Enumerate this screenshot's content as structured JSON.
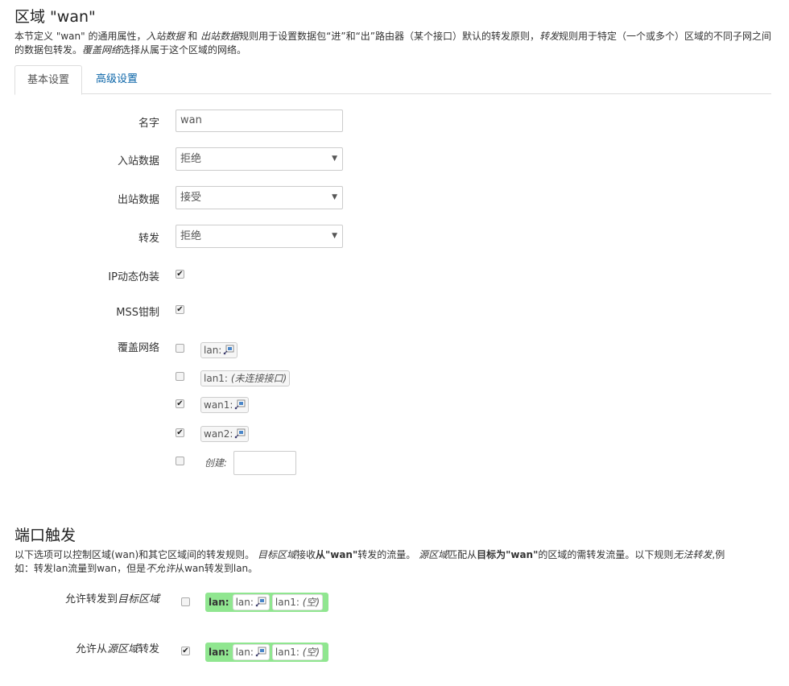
{
  "zone_section": {
    "title": "区域 \"wan\"",
    "desc_parts": [
      "本节定义 \"wan\" 的通用属性，",
      "入站数据",
      "和",
      "出站数据",
      "规则用于设置数据包“进”和“出”路由器（某个接口）默认的转发原则，",
      "转发",
      "规则用于特定（一个或多个）区域的不同子网之间的数据包转发。",
      "覆盖网络",
      "选择从属于这个区域的网络。"
    ]
  },
  "tabs": {
    "basic": "基本设置",
    "advanced": "高级设置"
  },
  "form": {
    "name_label": "名字",
    "name_value": "wan",
    "input_label": "入站数据",
    "input_value": "拒绝",
    "output_label": "出站数据",
    "output_value": "接受",
    "forward_label": "转发",
    "forward_value": "拒绝",
    "masq_label": "IP动态伪装",
    "mss_label": "MSS钳制",
    "network_label": "覆盖网络",
    "networks": [
      {
        "name": "lan:",
        "checked": false
      },
      {
        "name": "lan1:",
        "note": "(未连接接口)",
        "checked": false
      },
      {
        "name": "wan1:",
        "checked": true
      },
      {
        "name": "wan2:",
        "checked": true
      }
    ],
    "create_label": "创建:",
    "create_value": ""
  },
  "forwarding_section": {
    "title": "端口触发",
    "desc_line1_parts": [
      "以下选项可以控制区域(wan)和其它区域间的转发规则。",
      "目标区域",
      "接收",
      "从\"wan\"",
      "转发的流量。",
      "源区域",
      "匹配从",
      "目标为\"wan\"",
      "的区域的需转发流量。以下规则",
      "无法转发",
      ",例"
    ],
    "desc_line2_parts": [
      "如：转发lan流量到wan，但是",
      "不允许",
      "从wan转发到lan。"
    ],
    "dest_label_prefix": "允许转发到",
    "dest_label_em": "目标区域",
    "src_label_prefix": "允许从",
    "src_label_em": "源区域",
    "src_label_suffix": "转发",
    "dest_zone": {
      "name": "lan:",
      "badges": [
        "lan:",
        "lan1:"
      ],
      "lan1_note": "(空)"
    },
    "src_zone": {
      "name": "lan:",
      "badges": [
        "lan:",
        "lan1:"
      ],
      "lan1_note": "(空)"
    },
    "dest_checked": false,
    "src_checked": true
  },
  "colors": {
    "link": "#0b65a8",
    "zone_green": "#90e690"
  },
  "icons": {
    "net": "network-port-icon",
    "check": "checkmark-icon"
  }
}
